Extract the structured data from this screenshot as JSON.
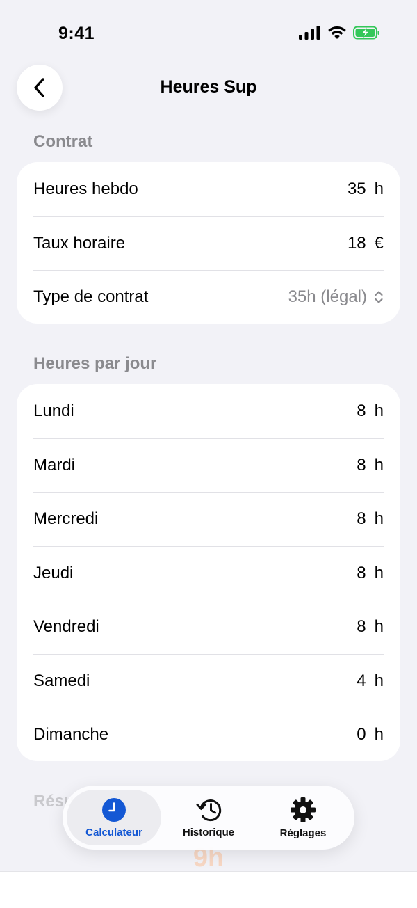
{
  "status_bar": {
    "time": "9:41"
  },
  "nav": {
    "title": "Heures Sup",
    "back_icon": "chevron-left-icon"
  },
  "contract": {
    "header": "Contrat",
    "rows": [
      {
        "label": "Heures hebdo",
        "value": "35",
        "unit": "h"
      },
      {
        "label": "Taux horaire",
        "value": "18",
        "unit": "€"
      },
      {
        "label": "Type de contrat",
        "value": "35h (légal)"
      }
    ]
  },
  "days": {
    "header": "Heures par jour",
    "rows": [
      {
        "label": "Lundi",
        "value": "8",
        "unit": "h"
      },
      {
        "label": "Mardi",
        "value": "8",
        "unit": "h"
      },
      {
        "label": "Mercredi",
        "value": "8",
        "unit": "h"
      },
      {
        "label": "Jeudi",
        "value": "8",
        "unit": "h"
      },
      {
        "label": "Vendredi",
        "value": "8",
        "unit": "h"
      },
      {
        "label": "Samedi",
        "value": "4",
        "unit": "h"
      },
      {
        "label": "Dimanche",
        "value": "0",
        "unit": "h"
      }
    ]
  },
  "results": {
    "header_partial": "Résu",
    "value": "9h"
  },
  "tab_bar": {
    "tabs": [
      {
        "label": "Calculateur",
        "icon": "clock-icon",
        "active": true
      },
      {
        "label": "Historique",
        "icon": "history-icon",
        "active": false
      },
      {
        "label": "Réglages",
        "icon": "gear-icon",
        "active": false
      }
    ]
  },
  "colors": {
    "accent": "#1458d4",
    "background": "#f2f2f7",
    "secondary_text": "#8a8a8e",
    "battery": "#34c759"
  }
}
